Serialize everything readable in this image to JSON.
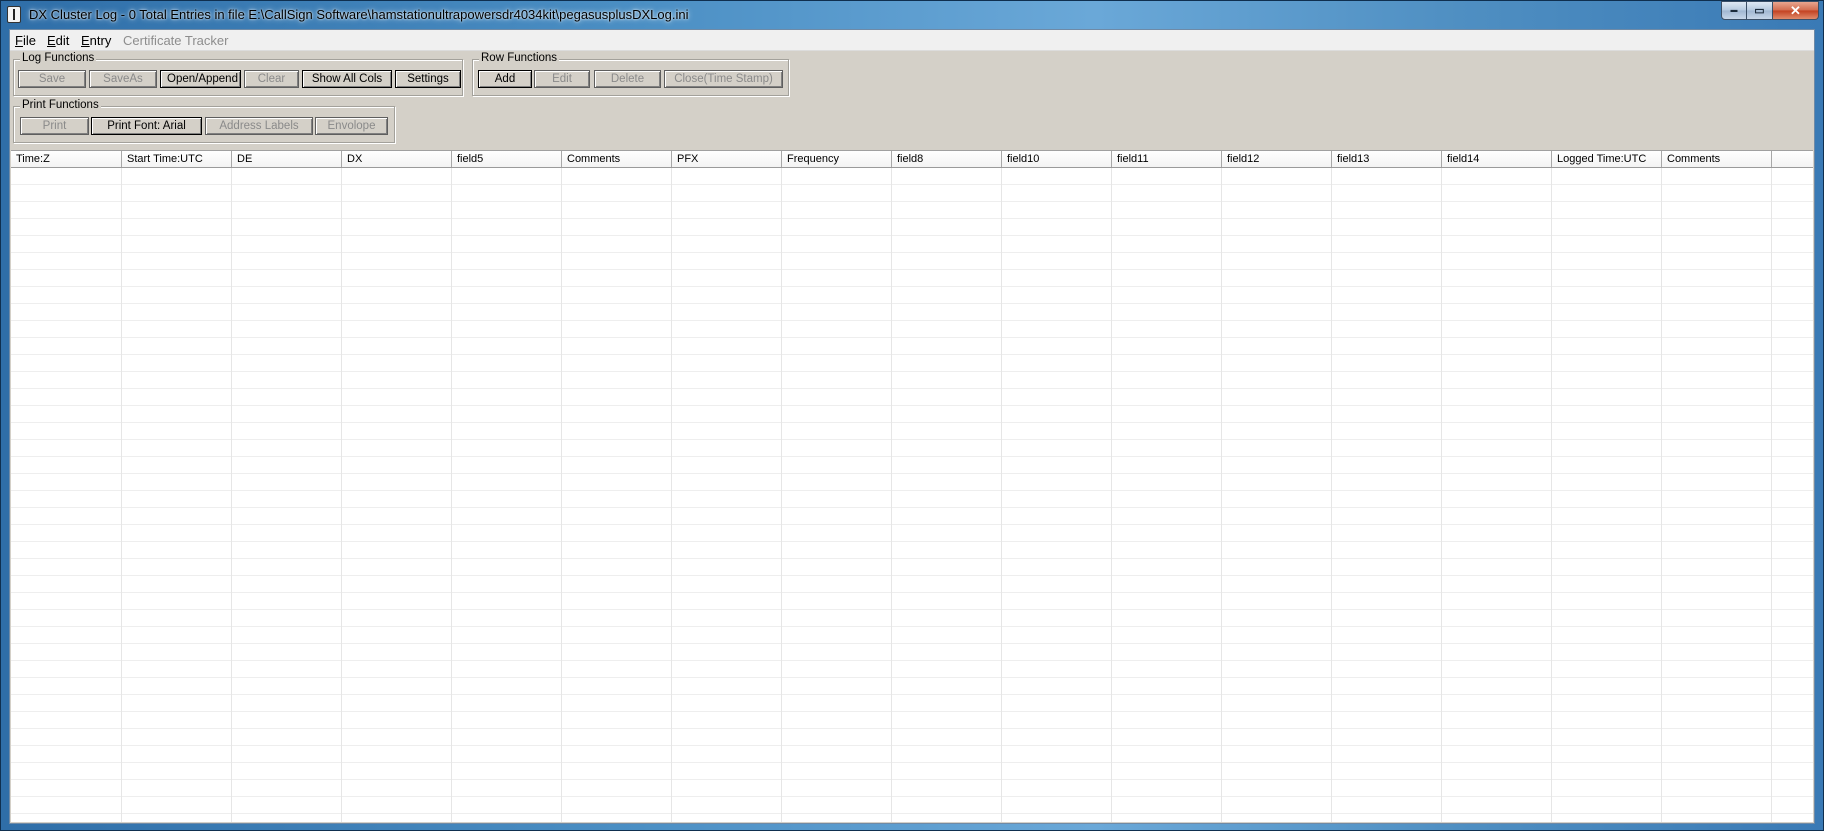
{
  "window": {
    "title": "DX Cluster Log - 0 Total Entries in file E:\\CallSign Software\\hamstationultrapowersdr4034kit\\pegasusplusDXLog.ini",
    "controls": {
      "minimize": "▬",
      "maximize": "▭",
      "close": "✕"
    }
  },
  "menu": [
    {
      "label_u": "F",
      "label_rest": "ile",
      "enabled": true
    },
    {
      "label_u": "E",
      "label_rest": "dit",
      "enabled": true
    },
    {
      "label_u": "E",
      "label_rest": "ntry",
      "enabled": true
    },
    {
      "label_u": "",
      "label_rest": "Certificate Tracker",
      "enabled": false
    }
  ],
  "log_functions": {
    "title": "Log Functions",
    "buttons": [
      {
        "label": "Save",
        "enabled": false
      },
      {
        "label": "SaveAs",
        "enabled": false
      },
      {
        "label": "Open/Append",
        "enabled": true
      },
      {
        "label": "Clear",
        "enabled": false
      },
      {
        "label": "Show All Cols",
        "enabled": true
      },
      {
        "label": "Settings",
        "enabled": true
      }
    ]
  },
  "row_functions": {
    "title": "Row Functions",
    "buttons": [
      {
        "label": "Add",
        "enabled": true
      },
      {
        "label": "Edit",
        "enabled": false
      },
      {
        "label": "Delete",
        "enabled": false
      },
      {
        "label": "Close(Time Stamp)",
        "enabled": false
      }
    ]
  },
  "print_functions": {
    "title": "Print Functions",
    "buttons": [
      {
        "label": "Print",
        "enabled": false
      },
      {
        "label": "Print Font: Arial",
        "enabled": true
      },
      {
        "label": "Address Labels",
        "enabled": false
      },
      {
        "label": "Envolope",
        "enabled": false
      }
    ]
  },
  "grid": {
    "columns": [
      "Time:Z",
      "Start Time:UTC",
      "DE",
      "DX",
      "field5",
      "Comments",
      "PFX",
      "Frequency",
      "field8",
      "field10",
      "field11",
      "field12",
      "field13",
      "field14",
      "Logged Time:UTC",
      "Comments"
    ],
    "rows": []
  }
}
